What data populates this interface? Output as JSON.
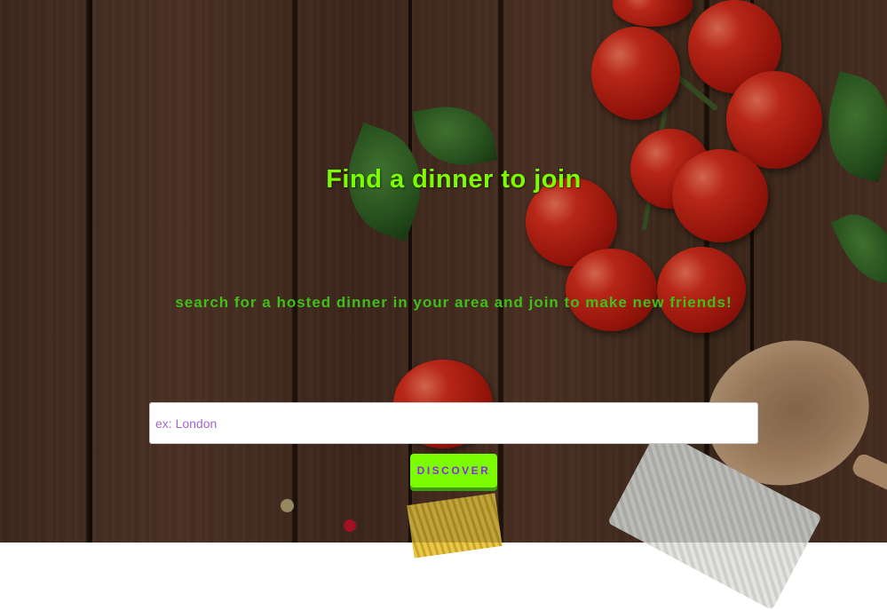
{
  "hero": {
    "title": "Find a dinner to join",
    "subtitle": "search for a hosted dinner in your area and join to make new friends!"
  },
  "search": {
    "placeholder": "ex: London",
    "value": ""
  },
  "actions": {
    "discover_label": "DISCOVER"
  },
  "colors": {
    "title": "#7cfc00",
    "subtitle": "#3fbf1a",
    "button_bg": "#7cfc00",
    "button_text": "#8a2be2",
    "placeholder": "#a466c9"
  }
}
